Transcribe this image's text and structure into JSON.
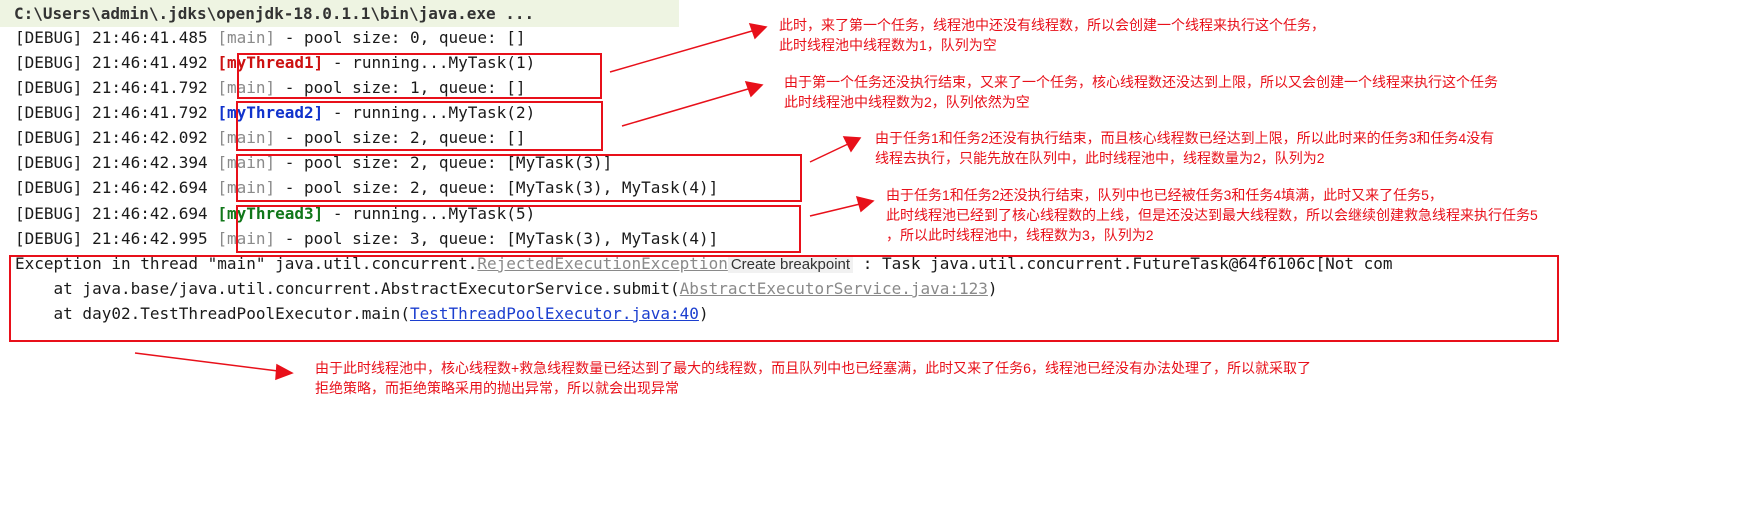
{
  "console": {
    "command": "C:\\Users\\admin\\.jdks\\openjdk-18.0.1.1\\bin\\java.exe ...",
    "lines": [
      {
        "level": "[DEBUG]",
        "time": "21:46:41.485",
        "thread": "[main]",
        "msg": " - pool size: 0, queue: []"
      },
      {
        "level": "[DEBUG]",
        "time": "21:46:41.492",
        "thread": "[myThread1]",
        "msg": " - running...MyTask(1)"
      },
      {
        "level": "[DEBUG]",
        "time": "21:46:41.792",
        "thread": "[main]",
        "msg": " - pool size: 1, queue: []"
      },
      {
        "level": "[DEBUG]",
        "time": "21:46:41.792",
        "thread": "[myThread2]",
        "msg": " - running...MyTask(2)"
      },
      {
        "level": "[DEBUG]",
        "time": "21:46:42.092",
        "thread": "[main]",
        "msg": " - pool size: 2, queue: []"
      },
      {
        "level": "[DEBUG]",
        "time": "21:46:42.394",
        "thread": "[main]",
        "msg": " - pool size: 2, queue: [MyTask(3)]"
      },
      {
        "level": "[DEBUG]",
        "time": "21:46:42.694",
        "thread": "[main]",
        "msg": " - pool size: 2, queue: [MyTask(3), MyTask(4)]"
      },
      {
        "level": "[DEBUG]",
        "time": "21:46:42.694",
        "thread": "[myThread3]",
        "msg": " - running...MyTask(5)"
      },
      {
        "level": "[DEBUG]",
        "time": "21:46:42.995",
        "thread": "[main]",
        "msg": " - pool size: 3, queue: [MyTask(3), MyTask(4)]"
      }
    ],
    "exception": {
      "prefix": "Exception in thread \"main\" java.util.concurrent.",
      "class_name": "RejectedExecutionException",
      "hint": "Create breakpoint",
      "suffix": " : Task java.util.concurrent.FutureTask@64f6106c[Not com",
      "frame1_prefix": "    at java.base/java.util.concurrent.AbstractExecutorService.submit(",
      "frame1_link": "AbstractExecutorService.java:123",
      "frame1_suffix": ")",
      "frame2_prefix": "    at day02.TestThreadPoolExecutor.main(",
      "frame2_link": "TestThreadPoolExecutor.java:40",
      "frame2_suffix": ")"
    }
  },
  "notes": [
    "此时，来了第一个任务，线程池中还没有线程数，所以会创建一个线程来执行这个任务，\n此时线程池中线程数为1，队列为空",
    "由于第一个任务还没执行结束，又来了一个任务，核心线程数还没达到上限，所以又会创建一个线程来执行这个任务\n此时线程池中线程数为2，队列依然为空",
    "由于任务1和任务2还没有执行结束，而且核心线程数已经达到上限，所以此时来的任务3和任务4没有\n线程去执行，只能先放在队列中，此时线程池中，线程数量为2，队列为2",
    "由于任务1和任务2还没执行结束，队列中也已经被任务3和任务4填满，此时又来了任务5，\n此时线程池已经到了核心线程数的上线，但是还没达到最大线程数，所以会继续创建救急线程来执行任务5\n，所以此时线程池中，线程数为3，队列为2",
    "由于此时线程池中，核心线程数+救急线程数量已经达到了最大的线程数，而且队列中也已经塞满，此时又来了任务6，线程池已经没有办法处理了，所以就采取了\n拒绝策略，而拒绝策略采用的抛出异常，所以就会出现异常"
  ],
  "colors": {
    "annotation": "#e8101a",
    "thread1": "#cc1111",
    "thread2": "#1133cc",
    "thread3": "#11771a",
    "muted": "#8a8a8a"
  }
}
